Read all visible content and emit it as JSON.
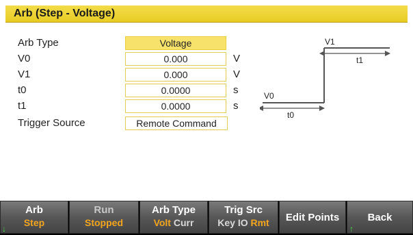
{
  "title": "Arb (Step - Voltage)",
  "fields": [
    {
      "label": "Arb Type",
      "value": "Voltage",
      "unit": ""
    },
    {
      "label": "V0",
      "value": "0.000",
      "unit": "V"
    },
    {
      "label": "V1",
      "value": "0.000",
      "unit": "V"
    },
    {
      "label": "t0",
      "value": "0.0000",
      "unit": "s"
    },
    {
      "label": "t1",
      "value": "0.0000",
      "unit": "s"
    },
    {
      "label": "Trigger Source",
      "value": "Remote Command",
      "unit": ""
    }
  ],
  "diagram": {
    "v0": "V0",
    "v1": "V1",
    "t0": "t0",
    "t1": "t1"
  },
  "softkeys": {
    "arb": {
      "line1": "Arb",
      "line2": "Step"
    },
    "run": {
      "line1": "Run",
      "line2": "Stopped"
    },
    "arb_type": {
      "line1": "Arb Type",
      "opt_a": "Volt",
      "opt_b": "Curr"
    },
    "trig_src": {
      "line1": "Trig Src",
      "opt_a": "Key",
      "opt_b": "IO",
      "opt_c": "Rmt"
    },
    "edit_points": {
      "label": "Edit Points"
    },
    "back": {
      "label": "Back"
    }
  },
  "colors": {
    "title_bar": "#e8cc24",
    "selected_field": "#f7e36c",
    "highlight_text": "#f3a51f",
    "softkey_bg": "#575757"
  },
  "icons": {
    "arb_key_arrow": "arrow-down-icon",
    "back_key_arrow": "arrow-up-icon"
  }
}
